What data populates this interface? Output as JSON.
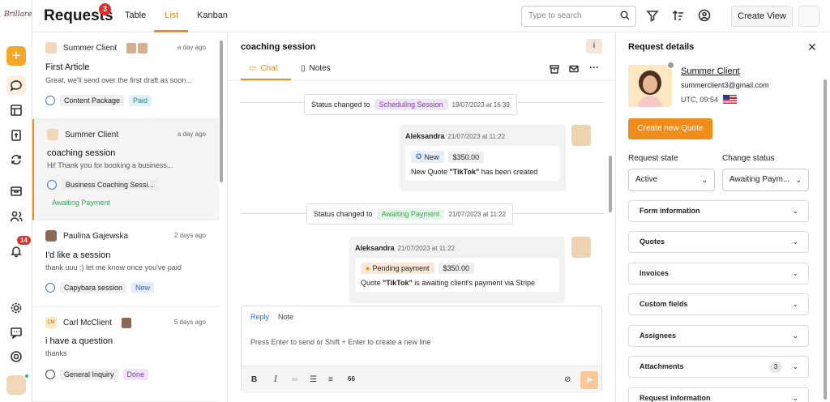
{
  "brand": {
    "logo_text": "Brillare"
  },
  "header": {
    "title": "Requests",
    "badge": "3",
    "tabs": [
      {
        "label": "Table"
      },
      {
        "label": "List"
      },
      {
        "label": "Kanban"
      }
    ],
    "active_tab": "List",
    "search_placeholder": "Type to search",
    "create_view_label": "Create View"
  },
  "rail": {
    "items": [
      "plus-icon",
      "chat-icon",
      "layout-icon",
      "invoice-icon",
      "sync-icon",
      "box-icon",
      "users-icon",
      "bell-icon",
      "settings-icon",
      "message-icon",
      "help-icon"
    ],
    "bell_badge": "14"
  },
  "list": {
    "items": [
      {
        "client": "Summer Client",
        "ago": "a day ago",
        "subject": "First Article",
        "preview": "Great, we'll send over the first draft as soon...",
        "tag": "Content Package",
        "status": "Paid"
      },
      {
        "client": "Summer Client",
        "ago": "a day ago",
        "subject": "coaching session",
        "preview": "Hi! Thank you for booking a business...",
        "tag": "Business Coaching Sessi...",
        "status": "Awaiting Payment"
      },
      {
        "client": "Paulina Gajewska",
        "ago": "2 days ago",
        "subject": "I'd like a session",
        "preview": "thank uuu :) let me know once you've paid",
        "tag": "Capybara session",
        "status": "New"
      },
      {
        "client": "Carl McClient",
        "initials": "CM",
        "ago": "5 days ago",
        "subject": "i have a question",
        "preview": "thanks",
        "tag": "General Inquiry",
        "status": "Done"
      }
    ]
  },
  "chat": {
    "title": "coaching session",
    "tabs": [
      {
        "label": "Chat"
      },
      {
        "label": "Notes"
      }
    ],
    "events": [
      {
        "prefix": "Status changed to",
        "status": "Scheduling Session",
        "date": "19/07/2023 at 16:39"
      },
      {
        "prefix": "Status changed to",
        "status": "Awaiting Payment",
        "date": "21/07/2023 at 11:22"
      }
    ],
    "messages": [
      {
        "author": "Aleksandra",
        "time": "21/07/2023 at 11:22",
        "pill": "New",
        "amount": "$350.00",
        "text_before": "New Quote ",
        "quote": "\"TikTok\"",
        "text_after": " has been created"
      },
      {
        "author": "Aleksandra",
        "time": "21/07/2023 at 11:22",
        "pill": "Pending payment",
        "amount": "$350.00",
        "text_before": "Quote ",
        "quote": "\"TikTok\"",
        "text_after": " is awaiting client's payment via Stripe"
      }
    ],
    "composer": {
      "reply_tab": "Reply",
      "note_tab": "Note",
      "placeholder": "Press Enter to send or Shift + Enter to create a new line",
      "quote_icon_label": "66"
    }
  },
  "details": {
    "title": "Request details",
    "client_name": "Summer Client",
    "client_email": "summerclient3@gmail.com",
    "timezone": "UTC, 09:54",
    "create_quote_label": "Create new Quote",
    "request_state_label": "Request state",
    "request_state_value": "Active",
    "change_status_label": "Change status",
    "change_status_value": "Awaiting Paym...",
    "sections": [
      {
        "label": "Form information"
      },
      {
        "label": "Quotes"
      },
      {
        "label": "Invoices"
      },
      {
        "label": "Custom fields"
      },
      {
        "label": "Assignees"
      },
      {
        "label": "Attachments",
        "count": "3"
      },
      {
        "label": "Request information"
      }
    ]
  },
  "colors": {
    "accent": "#f08c1a",
    "badge": "#d9312b",
    "green": "#3f9f5a"
  }
}
